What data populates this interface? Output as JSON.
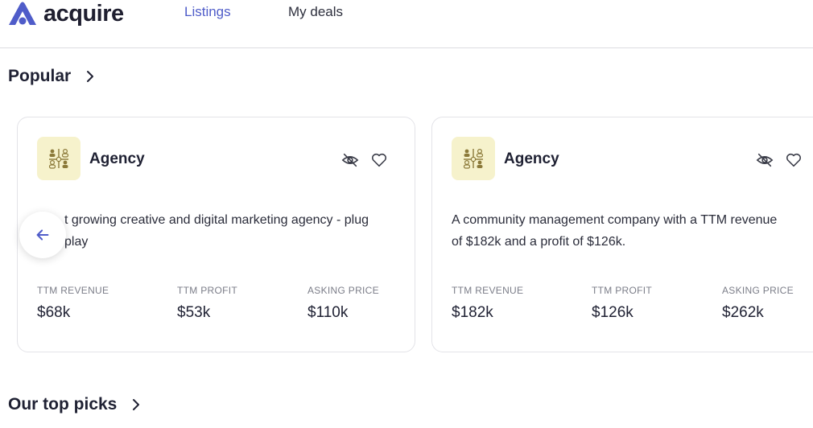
{
  "brand": {
    "name": "acquire",
    "accent": "#4f5cc9"
  },
  "nav": {
    "tabs": [
      {
        "label": "Listings",
        "active": true
      },
      {
        "label": "My deals",
        "active": false
      }
    ]
  },
  "sections": {
    "popular": {
      "title": "Popular"
    },
    "top_picks": {
      "title": "Our top picks"
    }
  },
  "cards": [
    {
      "category": "Agency",
      "description": "Fast growing creative and digital marketing agency - plug and play",
      "visible_description_lines": [
        "t growing creative and digital marketing agency - plug",
        "play"
      ],
      "metrics": [
        {
          "label": "TTM REVENUE",
          "value": "$68k"
        },
        {
          "label": "TTM PROFIT",
          "value": "$53k"
        },
        {
          "label": "ASKING PRICE",
          "value": "$110k"
        }
      ]
    },
    {
      "category": "Agency",
      "description": "A community management company with a TTM revenue of $182k and a profit of $126k.",
      "visible_description_lines": [
        "A community management company with a TTM revenue",
        "of $182k and a profit of $126k."
      ],
      "metrics": [
        {
          "label": "TTM REVENUE",
          "value": "$182k"
        },
        {
          "label": "TTM PROFIT",
          "value": "$126k"
        },
        {
          "label": "ASKING PRICE",
          "value": "$262k"
        }
      ]
    }
  ],
  "icons": {
    "logo": "acquire-logo-icon",
    "category": "agency-people-icon",
    "hide": "eye-off-icon",
    "favorite": "heart-icon",
    "chevron": "chevron-right-icon",
    "back": "arrow-left-icon"
  }
}
